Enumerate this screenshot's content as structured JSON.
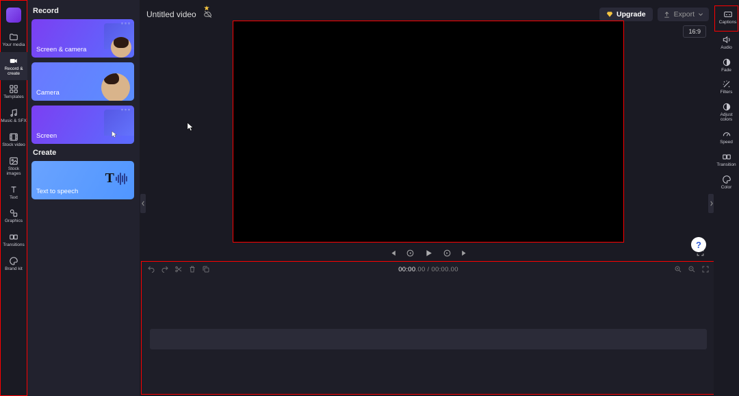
{
  "app": {
    "title": "Untitled video"
  },
  "toolbar": {
    "upgrade": "Upgrade",
    "export": "Export",
    "aspect_ratio": "16:9"
  },
  "leftrail": {
    "items": [
      {
        "label": "Your media"
      },
      {
        "label": "Record &\ncreate"
      },
      {
        "label": "Templates"
      },
      {
        "label": "Music & SFX"
      },
      {
        "label": "Stock video"
      },
      {
        "label": "Stock\nimages"
      },
      {
        "label": "Text"
      },
      {
        "label": "Graphics"
      },
      {
        "label": "Transitions"
      },
      {
        "label": "Brand kit"
      }
    ]
  },
  "panel": {
    "heading_record": "Record",
    "heading_create": "Create",
    "cards": {
      "screen_camera": "Screen & camera",
      "camera": "Camera",
      "screen": "Screen",
      "tts": "Text to speech"
    }
  },
  "timeline": {
    "current_primary": "00:00",
    "current_frac": ".00",
    "total_primary": "00:00",
    "total_frac": ".00"
  },
  "rightrail": {
    "items": [
      {
        "label": "Captions"
      },
      {
        "label": "Audio"
      },
      {
        "label": "Fade"
      },
      {
        "label": "Filters"
      },
      {
        "label": "Adjust\ncolors"
      },
      {
        "label": "Speed"
      },
      {
        "label": "Transition"
      },
      {
        "label": "Color"
      }
    ]
  },
  "help": {
    "glyph": "?"
  }
}
